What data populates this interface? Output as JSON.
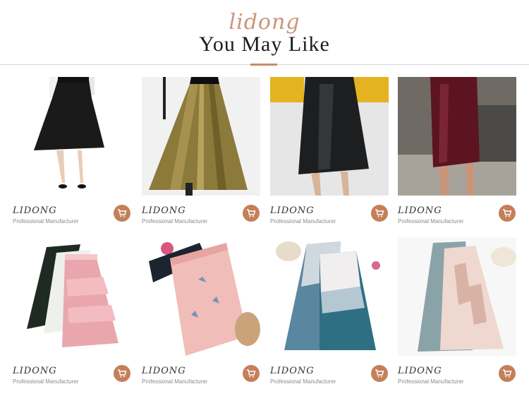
{
  "header": {
    "script_text": "lidong",
    "title": "You May Like"
  },
  "products": [
    {
      "brand": "LIDONG",
      "subtitle": "Professional Manufacturer",
      "item": "black flared skirt"
    },
    {
      "brand": "LIDONG",
      "subtitle": "Professional Manufacturer",
      "item": "gold pleated skirt"
    },
    {
      "brand": "LIDONG",
      "subtitle": "Professional Manufacturer",
      "item": "black leather skirt"
    },
    {
      "brand": "LIDONG",
      "subtitle": "Professional Manufacturer",
      "item": "burgundy leather pencil skirt"
    },
    {
      "brand": "LIDONG",
      "subtitle": "Professional Manufacturer",
      "item": "tiered tulle skirts black white pink"
    },
    {
      "brand": "LIDONG",
      "subtitle": "Professional Manufacturer",
      "item": "pink tulle skirt with feather print"
    },
    {
      "brand": "LIDONG",
      "subtitle": "Professional Manufacturer",
      "item": "gradient pleated skirts"
    },
    {
      "brand": "LIDONG",
      "subtitle": "Professional Manufacturer",
      "item": "layered mesh skirt"
    }
  ],
  "colors": {
    "accent": "#c78c6a",
    "cart_button": "#c4805a",
    "script": "#c9967a"
  },
  "icons": {
    "cart": "shopping-cart-icon"
  }
}
